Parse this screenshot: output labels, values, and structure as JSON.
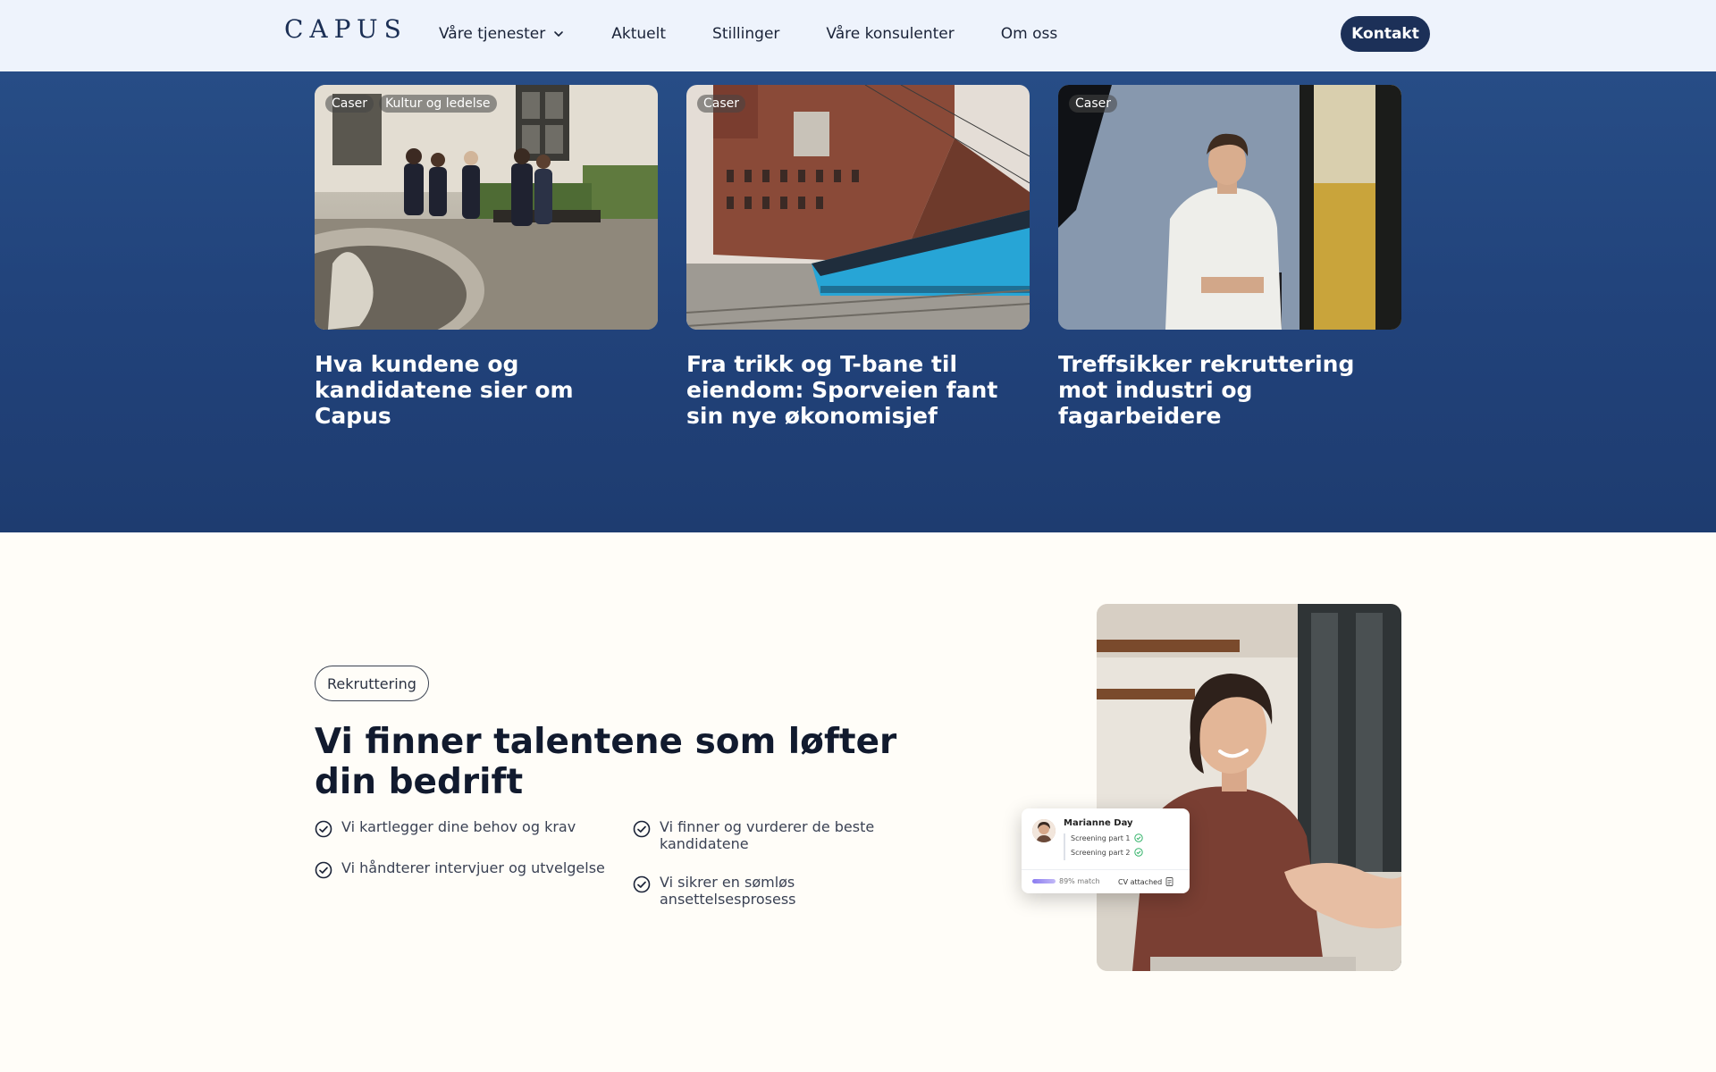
{
  "header": {
    "logo": "CAPUS",
    "nav": [
      {
        "label": "Våre tjenester",
        "has_dropdown": true
      },
      {
        "label": "Aktuelt"
      },
      {
        "label": "Stillinger"
      },
      {
        "label": "Våre konsulenter"
      },
      {
        "label": "Om oss"
      }
    ],
    "contact_label": "Kontakt"
  },
  "cards": [
    {
      "tags": [
        "Caser",
        "Kultur og ledelse"
      ],
      "title": "Hva kundene og kandidatene sier om Capus"
    },
    {
      "tags": [
        "Caser"
      ],
      "title": "Fra trikk og T-bane til eiendom: Sporveien fant sin nye økonomisjef"
    },
    {
      "tags": [
        "Caser"
      ],
      "title": "Treffsikker rekruttering mot industri og fagarbeidere"
    }
  ],
  "section": {
    "tag": "Rekruttering",
    "headline": "Vi finner talentene som løfter din bedrift",
    "bullets_left": [
      "Vi kartlegger dine behov og krav",
      "Vi håndterer intervjuer og utvelgelse"
    ],
    "bullets_right": [
      "Vi finner og vurderer de beste kandidatene",
      "Vi sikrer en sømløs ansettelsesprosess"
    ]
  },
  "float_card": {
    "name": "Marianne Day",
    "steps": [
      "Screening part 1",
      "Screening part 2"
    ],
    "match": "89% match",
    "match_fraction": 0.89,
    "cv": "CV attached"
  },
  "colors": {
    "band": "#21427a",
    "header_bg": "#eef3fc",
    "button": "#1c3058",
    "check_green": "#34b36a"
  }
}
